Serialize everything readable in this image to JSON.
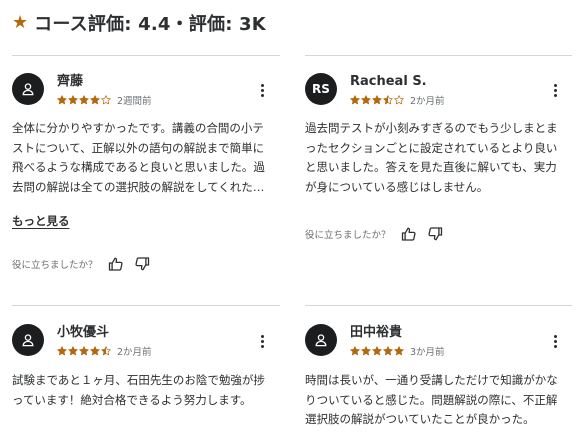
{
  "header": {
    "title": "コース評価: 4.4・評価: 3K",
    "icon": "star-icon",
    "accent_color": "#b4690e"
  },
  "reviews": [
    {
      "name": "齊藤",
      "avatar_text": "",
      "avatar_icon": "person-icon",
      "rating": 4,
      "date": "2週間前",
      "text": "全体に分かりやすかったです。講義の合間の小テストについて、正解以外の語句の解説まで簡単に飛べるような構成であると良いと思いました。過去問の解説は全ての選択肢の解説をしてくれたので勉強の効率が良かったです。",
      "more_label": "もっと見る",
      "helpful_label": "役に立ちましたか？"
    },
    {
      "name": "Racheal S.",
      "avatar_text": "RS",
      "rating": 3.5,
      "date": "2か月前",
      "text": "過去問テストが小刻みすぎるのでもう少しまとまったセクションごとに設定されているとより良いと思いました。答えを見た直後に解いても、実力が身についている感じはしません。",
      "helpful_label": "役に立ちましたか？"
    },
    {
      "name": "小牧優斗",
      "avatar_text": "",
      "avatar_icon": "person-icon",
      "rating": 4.5,
      "date": "2か月前",
      "text": "試験まであと１ヶ月、石田先生のお陰で勉強が捗っています！絶対合格できるよう努力します。"
    },
    {
      "name": "田中裕貴",
      "avatar_text": "",
      "avatar_icon": "person-icon",
      "rating": 5,
      "date": "3か月前",
      "text": "時間は長いが、一通り受講しただけで知識がかなりついていると感じた。問題解説の際に、不正解選択肢の解説がついていたことが良かった。"
    }
  ],
  "colors": {
    "star": "#b4690e",
    "avatar_bg": "#1c1d1f",
    "divider": "#d1d7dc",
    "muted_text": "#6a6f73"
  }
}
